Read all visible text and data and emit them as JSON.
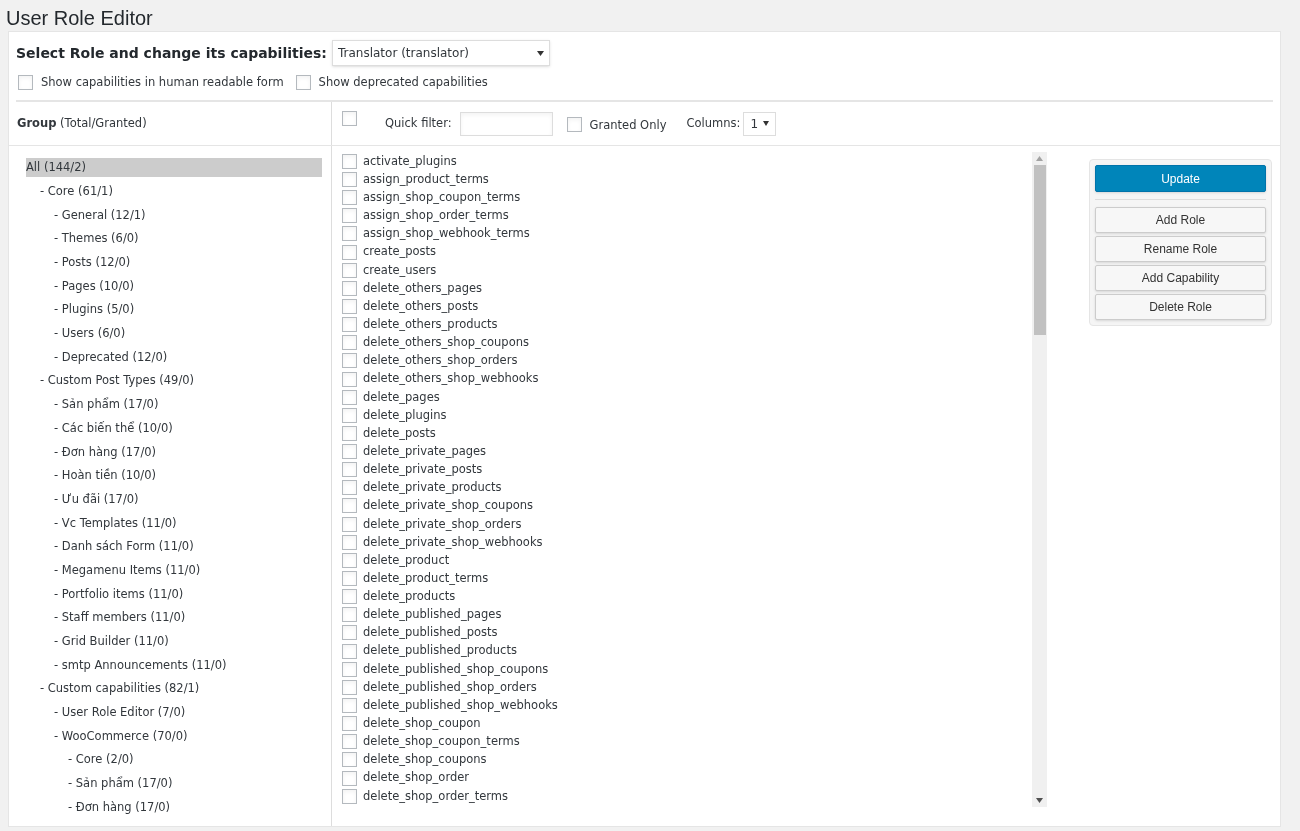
{
  "page_title": "User Role Editor",
  "role_select": {
    "label": "Select Role and change its capabilities:",
    "value": "Translator (translator)"
  },
  "options": [
    {
      "label": "Show capabilities in human readable form",
      "checked": false
    },
    {
      "label": "Show deprecated capabilities",
      "checked": false
    }
  ],
  "groups_header": {
    "title": "Group",
    "subtitle": "(Total/Granted)"
  },
  "groups": [
    {
      "label": "All (144/2)",
      "selected": true,
      "children": [
        {
          "label": "- Core (61/1)",
          "selected": false,
          "children": [
            {
              "label": "- General (12/1)",
              "selected": false
            },
            {
              "label": "- Themes (6/0)",
              "selected": false
            },
            {
              "label": "- Posts (12/0)",
              "selected": false
            },
            {
              "label": "- Pages (10/0)",
              "selected": false
            },
            {
              "label": "- Plugins (5/0)",
              "selected": false
            },
            {
              "label": "- Users (6/0)",
              "selected": false
            },
            {
              "label": "- Deprecated (12/0)",
              "selected": false
            }
          ]
        },
        {
          "label": "- Custom Post Types (49/0)",
          "selected": false,
          "children": [
            {
              "label": "- Sản phẩm (17/0)",
              "selected": false
            },
            {
              "label": "- Các biến thể (10/0)",
              "selected": false
            },
            {
              "label": "- Đơn hàng (17/0)",
              "selected": false
            },
            {
              "label": "- Hoàn tiền (10/0)",
              "selected": false
            },
            {
              "label": "- Ưu đãi (17/0)",
              "selected": false
            },
            {
              "label": "- Vc Templates (11/0)",
              "selected": false
            },
            {
              "label": "- Danh sách Form (11/0)",
              "selected": false
            },
            {
              "label": "- Megamenu Items (11/0)",
              "selected": false
            },
            {
              "label": "- Portfolio items (11/0)",
              "selected": false
            },
            {
              "label": "- Staff members (11/0)",
              "selected": false
            },
            {
              "label": "- Grid Builder (11/0)",
              "selected": false
            },
            {
              "label": "- smtp Announcements (11/0)",
              "selected": false
            }
          ]
        },
        {
          "label": "- Custom capabilities (82/1)",
          "selected": false,
          "children": [
            {
              "label": "- User Role Editor (7/0)",
              "selected": false
            },
            {
              "label": "- WooCommerce (70/0)",
              "selected": false,
              "children": [
                {
                  "label": "- Core (2/0)",
                  "selected": false
                },
                {
                  "label": "- Sản phẩm (17/0)",
                  "selected": false
                },
                {
                  "label": "- Đơn hàng (17/0)",
                  "selected": false
                }
              ]
            }
          ]
        }
      ]
    }
  ],
  "toolbar": {
    "select_all_checked": false,
    "quick_filter_label": "Quick filter:",
    "granted_only": {
      "label": "Granted Only",
      "checked": false
    },
    "columns_label": "Columns:",
    "columns_value": "1"
  },
  "capabilities": [
    {
      "name": "activate_plugins",
      "checked": false
    },
    {
      "name": "assign_product_terms",
      "checked": false
    },
    {
      "name": "assign_shop_coupon_terms",
      "checked": false
    },
    {
      "name": "assign_shop_order_terms",
      "checked": false
    },
    {
      "name": "assign_shop_webhook_terms",
      "checked": false
    },
    {
      "name": "create_posts",
      "checked": false
    },
    {
      "name": "create_users",
      "checked": false
    },
    {
      "name": "delete_others_pages",
      "checked": false
    },
    {
      "name": "delete_others_posts",
      "checked": false
    },
    {
      "name": "delete_others_products",
      "checked": false
    },
    {
      "name": "delete_others_shop_coupons",
      "checked": false
    },
    {
      "name": "delete_others_shop_orders",
      "checked": false
    },
    {
      "name": "delete_others_shop_webhooks",
      "checked": false
    },
    {
      "name": "delete_pages",
      "checked": false
    },
    {
      "name": "delete_plugins",
      "checked": false
    },
    {
      "name": "delete_posts",
      "checked": false
    },
    {
      "name": "delete_private_pages",
      "checked": false
    },
    {
      "name": "delete_private_posts",
      "checked": false
    },
    {
      "name": "delete_private_products",
      "checked": false
    },
    {
      "name": "delete_private_shop_coupons",
      "checked": false
    },
    {
      "name": "delete_private_shop_orders",
      "checked": false
    },
    {
      "name": "delete_private_shop_webhooks",
      "checked": false
    },
    {
      "name": "delete_product",
      "checked": false
    },
    {
      "name": "delete_product_terms",
      "checked": false
    },
    {
      "name": "delete_products",
      "checked": false
    },
    {
      "name": "delete_published_pages",
      "checked": false
    },
    {
      "name": "delete_published_posts",
      "checked": false
    },
    {
      "name": "delete_published_products",
      "checked": false
    },
    {
      "name": "delete_published_shop_coupons",
      "checked": false
    },
    {
      "name": "delete_published_shop_orders",
      "checked": false
    },
    {
      "name": "delete_published_shop_webhooks",
      "checked": false
    },
    {
      "name": "delete_shop_coupon",
      "checked": false
    },
    {
      "name": "delete_shop_coupon_terms",
      "checked": false
    },
    {
      "name": "delete_shop_coupons",
      "checked": false
    },
    {
      "name": "delete_shop_order",
      "checked": false
    },
    {
      "name": "delete_shop_order_terms",
      "checked": false
    }
  ],
  "actions": [
    {
      "label": "Update",
      "kind": "primary"
    },
    {
      "label": "Add Role",
      "kind": "secondary"
    },
    {
      "label": "Rename Role",
      "kind": "secondary"
    },
    {
      "label": "Add Capability",
      "kind": "secondary"
    },
    {
      "label": "Delete Role",
      "kind": "secondary"
    }
  ]
}
